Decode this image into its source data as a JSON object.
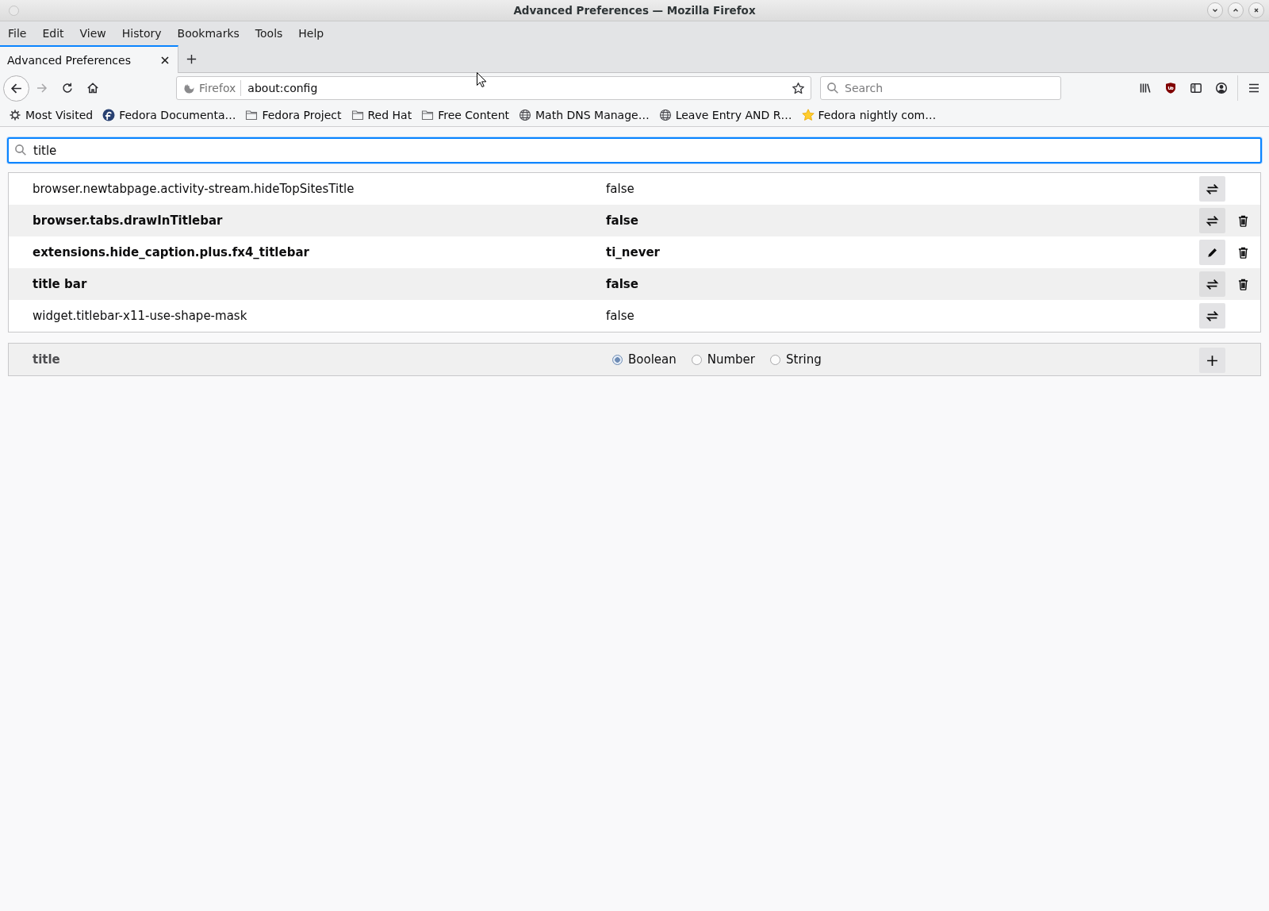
{
  "window": {
    "title": "Advanced Preferences — Mozilla Firefox"
  },
  "menu_bar": [
    {
      "label": "File"
    },
    {
      "label": "Edit"
    },
    {
      "label": "View"
    },
    {
      "label": "History"
    },
    {
      "label": "Bookmarks"
    },
    {
      "label": "Tools"
    },
    {
      "label": "Help"
    }
  ],
  "tabs": [
    {
      "label": "Advanced Preferences",
      "selected": true
    }
  ],
  "nav_bar": {
    "identity_label": "Firefox",
    "url": "about:config",
    "search": {
      "placeholder": "Search"
    }
  },
  "bookmarks_toolbar": [
    {
      "label": "Most Visited",
      "kind": "smart"
    },
    {
      "label": "Fedora Documenta…",
      "kind": "page"
    },
    {
      "label": "Fedora Project",
      "kind": "folder"
    },
    {
      "label": "Red Hat",
      "kind": "folder"
    },
    {
      "label": "Free Content",
      "kind": "folder"
    },
    {
      "label": "Math DNS Manage…",
      "kind": "page"
    },
    {
      "label": "Leave Entry AND R…",
      "kind": "page"
    },
    {
      "label": "Fedora nightly com…",
      "kind": "page"
    }
  ],
  "filter": {
    "value": "title"
  },
  "preferences": [
    {
      "name": "browser.newtabpage.activity-stream.hideTopSitesTitle",
      "value": "false",
      "modified": false,
      "kind": "boolean",
      "deletable": false
    },
    {
      "name": "browser.tabs.drawInTitlebar",
      "value": "false",
      "modified": true,
      "kind": "boolean",
      "deletable": true
    },
    {
      "name": "extensions.hide_caption.plus.fx4_titlebar",
      "value": "ti_never",
      "modified": true,
      "kind": "string",
      "deletable": true
    },
    {
      "name": "title bar",
      "value": "false",
      "modified": true,
      "kind": "boolean",
      "deletable": true
    },
    {
      "name": "widget.titlebar-x11-use-shape-mask",
      "value": "false",
      "modified": false,
      "kind": "boolean",
      "deletable": false
    }
  ],
  "new_preference": {
    "name": "title",
    "types": [
      {
        "label": "Boolean",
        "selected": true
      },
      {
        "label": "Number",
        "selected": false
      },
      {
        "label": "String",
        "selected": false
      }
    ]
  }
}
